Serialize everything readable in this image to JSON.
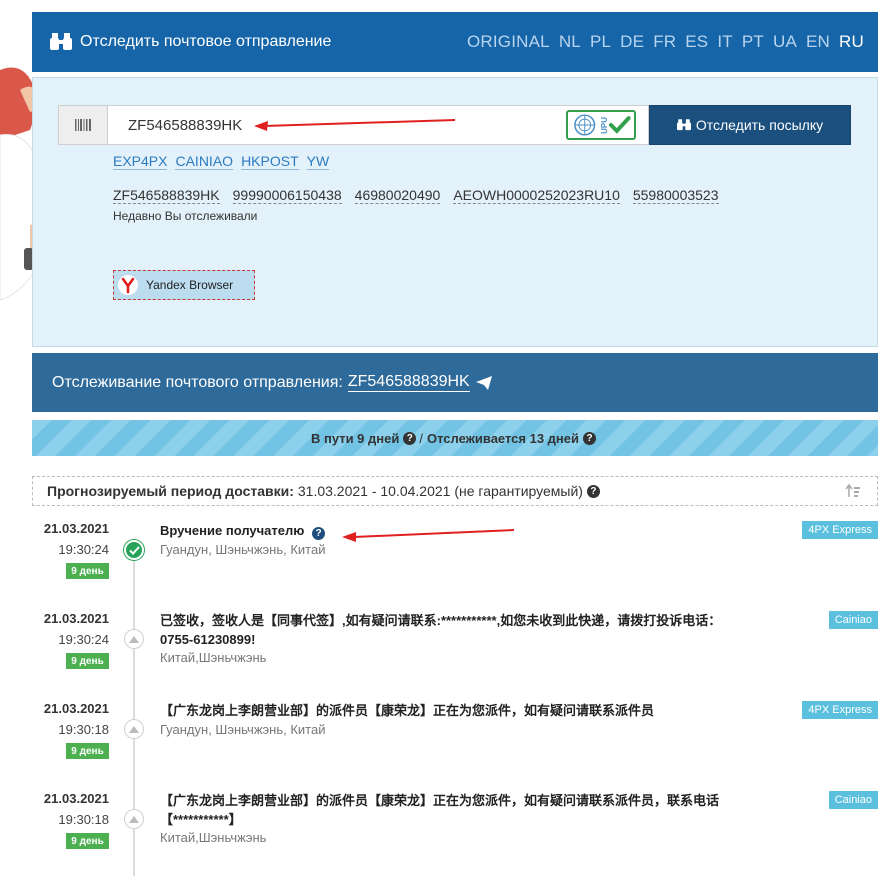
{
  "header": {
    "title": "Отследить почтовое отправление",
    "languages": [
      "ORIGINAL",
      "NL",
      "PL",
      "DE",
      "FR",
      "ES",
      "IT",
      "PT",
      "UA",
      "EN",
      "RU"
    ],
    "active_language": "RU"
  },
  "search": {
    "value": "ZF546588839HK",
    "button_label": "Отследить посылку",
    "upu_label": "UPU",
    "carriers": [
      "EXP4PX",
      "CAINIAO",
      "HKPOST",
      "YW"
    ],
    "recent": [
      "ZF546588839HK",
      "99990006150438",
      "46980020490",
      "AEOWH0000252023RU10",
      "55980003523"
    ],
    "recent_label": "Недавно Вы отслеживали",
    "browser_label": "Yandex Browser"
  },
  "tracking": {
    "label": "Отслеживание почтового отправления:",
    "number": "ZF546588839HK",
    "in_transit": "В пути 9 дней",
    "separator": "/",
    "tracked": "Отслеживается 13 дней",
    "forecast_label": "Прогнозируемый период доставки:",
    "forecast_value": "31.03.2021 - 10.04.2021 (не гарантируемый)"
  },
  "events": [
    {
      "date": "21.03.2021",
      "time": "19:30:24",
      "day": "9 день",
      "title": "Вручение получателю",
      "location": "Гуандун, Шэньчжэнь, Китай",
      "source": "4PX Express"
    },
    {
      "date": "21.03.2021",
      "time": "19:30:24",
      "day": "9 день",
      "title": "已签收，签收人是【同事代签】,如有疑问请联系:***********,如您未收到此快递，请拨打投诉电话：0755-61230899!",
      "location": "Китай,Шэньчжэнь",
      "source": "Cainiao"
    },
    {
      "date": "21.03.2021",
      "time": "19:30:18",
      "day": "9 день",
      "title": "【广东龙岗上李朗营业部】的派件员【康荣龙】正在为您派件，如有疑问请联系派件员",
      "location": "Гуандун, Шэньчжэнь, Китай",
      "source": "4PX Express"
    },
    {
      "date": "21.03.2021",
      "time": "19:30:18",
      "day": "9 день",
      "title": "【广东龙岗上李朗营业部】的派件员【康荣龙】正在为您派件，如有疑问请联系派件员，联系电话【***********】",
      "location": "Китай,Шэньчжэнь",
      "source": "Cainiao"
    }
  ],
  "colors": {
    "header_bg": "#1565a8",
    "button_bg": "#1a4f7e",
    "badge_day": "#4caf50",
    "badge_source": "#5bc0de",
    "arrow": "#e02020"
  }
}
